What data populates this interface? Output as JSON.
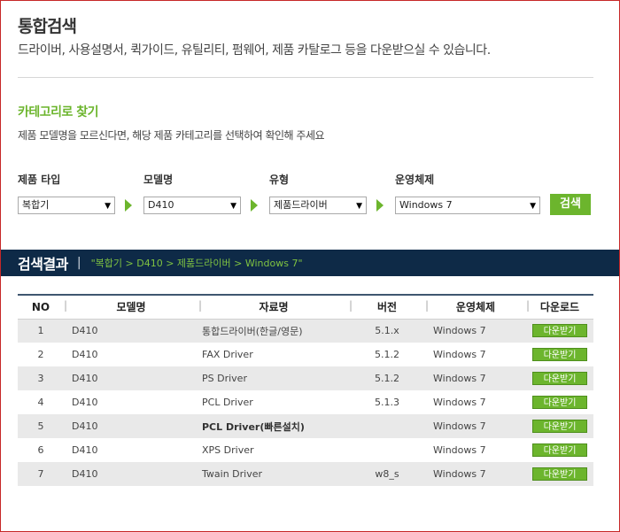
{
  "header": {
    "title": "통합검색",
    "description": "드라이버, 사용설명서, 퀵가이드, 유틸리티, 펌웨어, 제품 카탈로그 등을 다운받으실 수 있습니다."
  },
  "category": {
    "title": "카테고리로 찾기",
    "description": "제품 모델명을 모르신다면, 해당 제품 카테고리를 선택하여 확인해 주세요"
  },
  "filters": {
    "product_type": {
      "label": "제품 타입",
      "value": "복합기"
    },
    "model": {
      "label": "모델명",
      "value": "D410"
    },
    "kind": {
      "label": "유형",
      "value": "제품드라이버"
    },
    "os": {
      "label": "운영체제",
      "value": "Windows 7"
    },
    "search_label": "검색"
  },
  "results": {
    "title": "검색결과",
    "breadcrumb": "\"복합기 > D410 > 제품드라이버 > Windows 7\"",
    "columns": [
      "NO",
      "모델명",
      "자료명",
      "버전",
      "운영체제",
      "다운로드"
    ],
    "download_label": "다운받기",
    "rows": [
      {
        "no": "1",
        "model": "D410",
        "name": "통합드라이버(한글/영문)",
        "version": "5.1.x",
        "os": "Windows 7"
      },
      {
        "no": "2",
        "model": "D410",
        "name": "FAX Driver",
        "version": "5.1.2",
        "os": "Windows 7"
      },
      {
        "no": "3",
        "model": "D410",
        "name": "PS Driver",
        "version": "5.1.2",
        "os": "Windows 7"
      },
      {
        "no": "4",
        "model": "D410",
        "name": "PCL Driver",
        "version": "5.1.3",
        "os": "Windows 7"
      },
      {
        "no": "5",
        "model": "D410",
        "name": "PCL Driver(빠른설치)",
        "version": "",
        "os": "Windows 7"
      },
      {
        "no": "6",
        "model": "D410",
        "name": "XPS Driver",
        "version": "",
        "os": "Windows 7"
      },
      {
        "no": "7",
        "model": "D410",
        "name": "Twain Driver",
        "version": "w8_s",
        "os": "Windows 7"
      }
    ]
  },
  "colors": {
    "accent": "#6cb52d",
    "result_bar": "#0e2a47"
  }
}
